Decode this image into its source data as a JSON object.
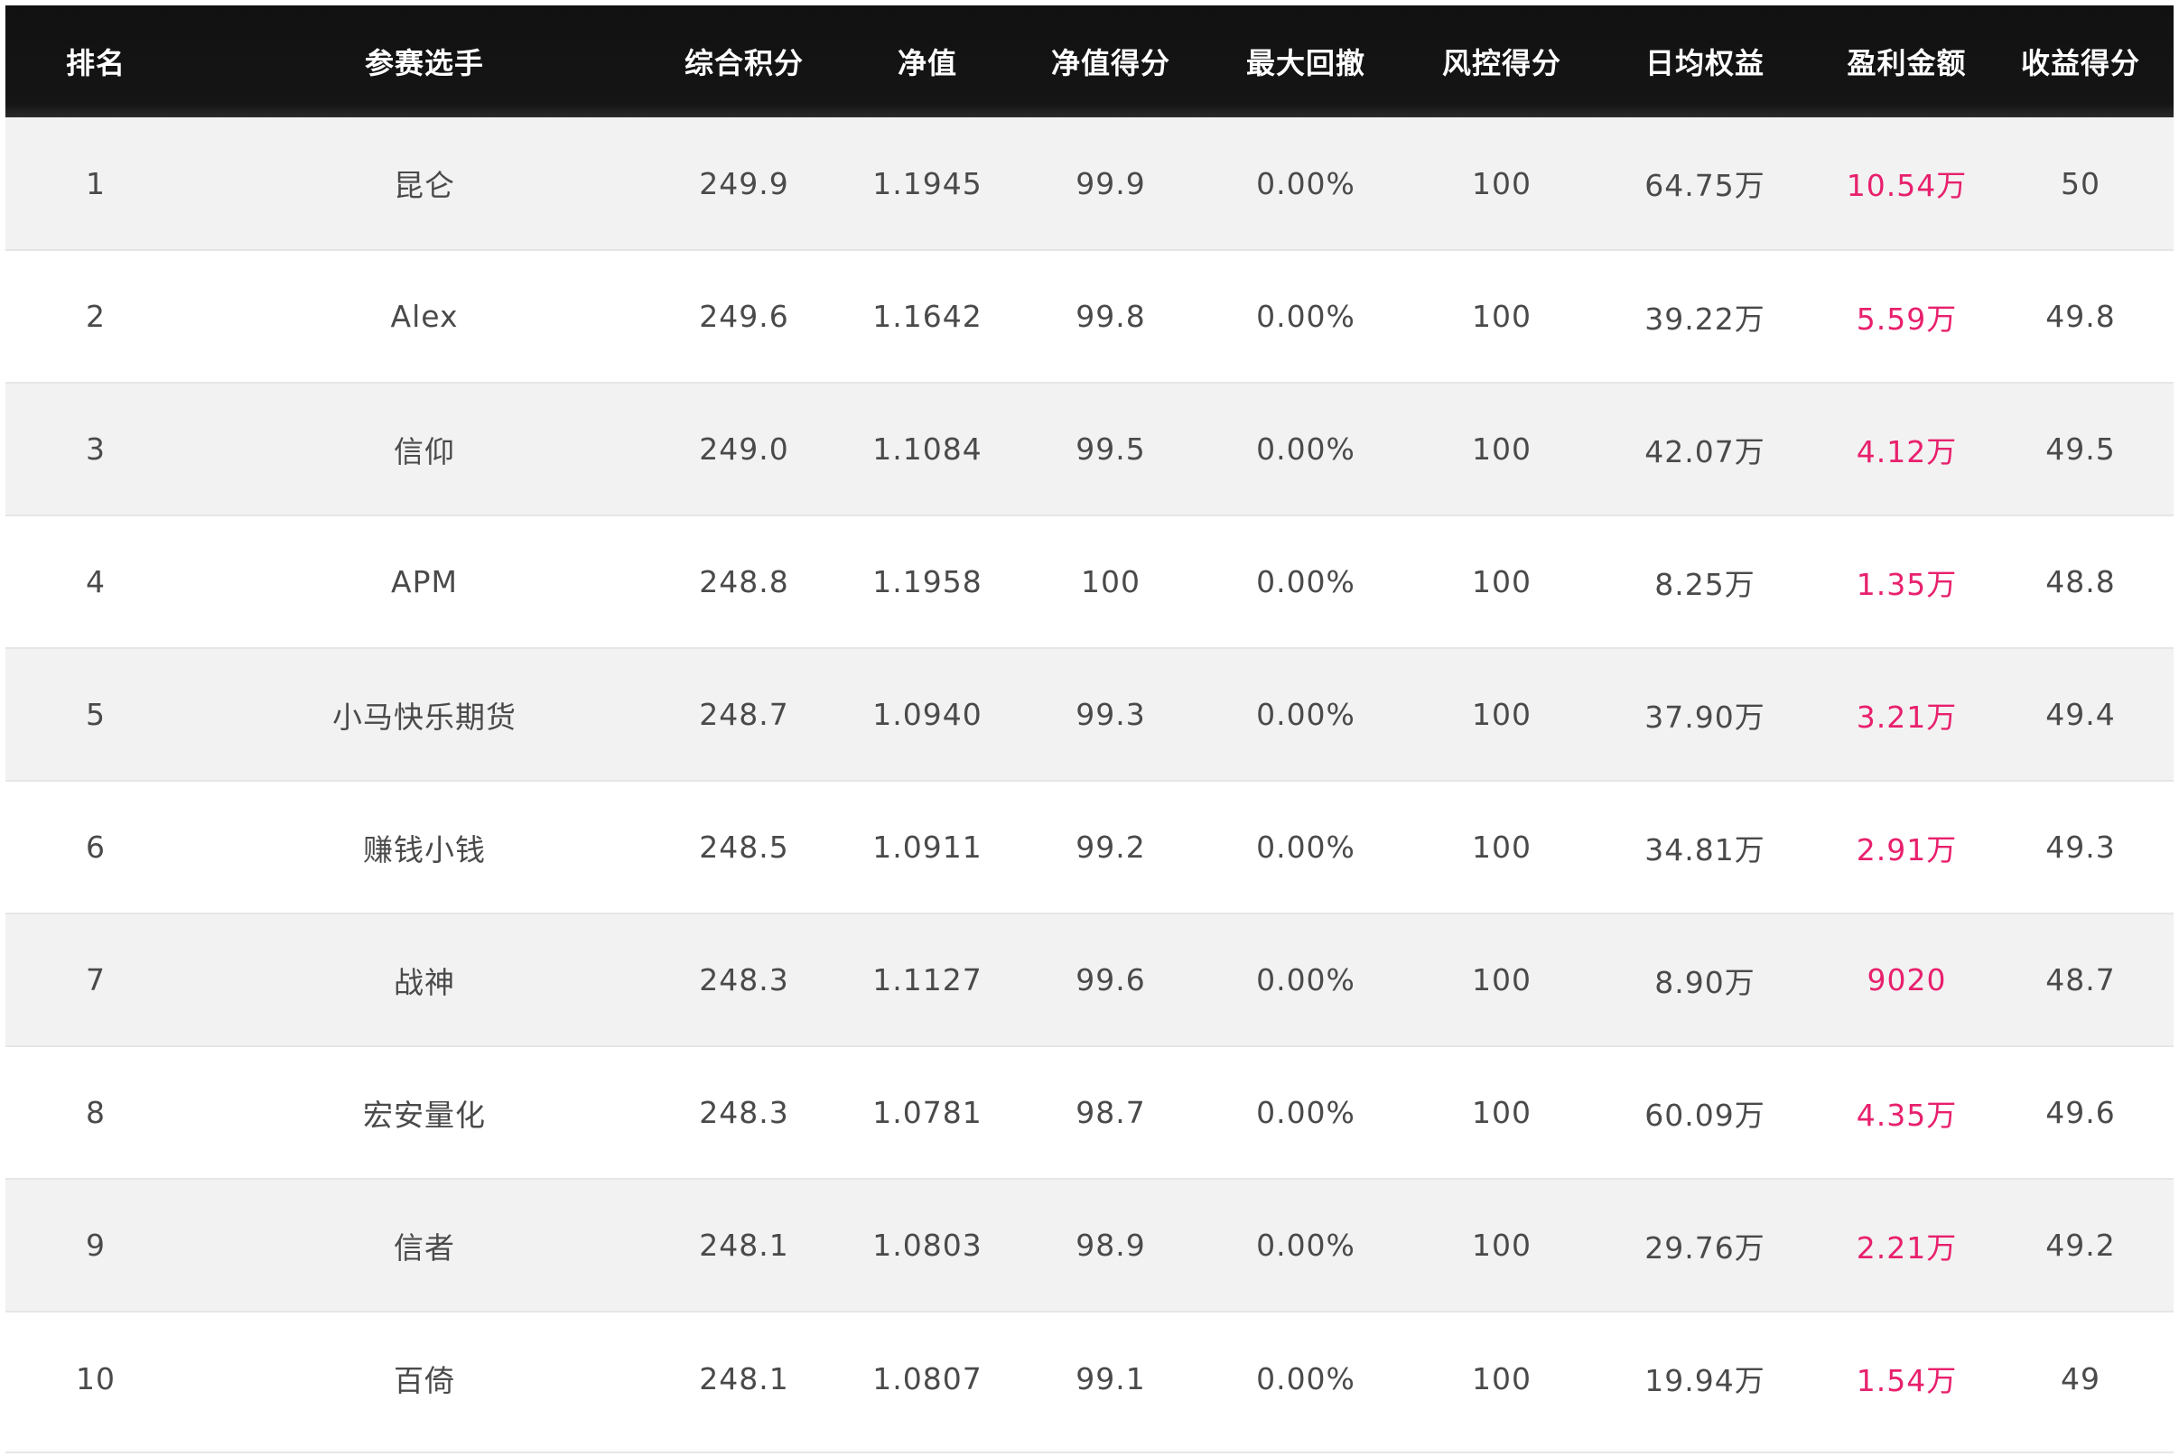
{
  "table": {
    "headers": [
      "排名",
      "参赛选手",
      "综合积分",
      "净值",
      "净值得分",
      "最大回撤",
      "风控得分",
      "日均权益",
      "盈利金额",
      "收益得分"
    ],
    "rows": [
      [
        "1",
        "昆仑",
        "249.9",
        "1.1945",
        "99.9",
        "0.00%",
        "100",
        "64.75万",
        "10.54万",
        "50"
      ],
      [
        "2",
        "Alex",
        "249.6",
        "1.1642",
        "99.8",
        "0.00%",
        "100",
        "39.22万",
        "5.59万",
        "49.8"
      ],
      [
        "3",
        "信仰",
        "249.0",
        "1.1084",
        "99.5",
        "0.00%",
        "100",
        "42.07万",
        "4.12万",
        "49.5"
      ],
      [
        "4",
        "APM",
        "248.8",
        "1.1958",
        "100",
        "0.00%",
        "100",
        "8.25万",
        "1.35万",
        "48.8"
      ],
      [
        "5",
        "小马快乐期货",
        "248.7",
        "1.0940",
        "99.3",
        "0.00%",
        "100",
        "37.90万",
        "3.21万",
        "49.4"
      ],
      [
        "6",
        "赚钱小钱",
        "248.5",
        "1.0911",
        "99.2",
        "0.00%",
        "100",
        "34.81万",
        "2.91万",
        "49.3"
      ],
      [
        "7",
        "战神",
        "248.3",
        "1.1127",
        "99.6",
        "0.00%",
        "100",
        "8.90万",
        "9020",
        "48.7"
      ],
      [
        "8",
        "宏安量化",
        "248.3",
        "1.0781",
        "98.7",
        "0.00%",
        "100",
        "60.09万",
        "4.35万",
        "49.6"
      ],
      [
        "9",
        "信者",
        "248.1",
        "1.0803",
        "98.9",
        "0.00%",
        "100",
        "29.76万",
        "2.21万",
        "49.2"
      ],
      [
        "10",
        "百倚",
        "248.1",
        "1.0807",
        "99.1",
        "0.00%",
        "100",
        "19.94万",
        "1.54万",
        "49"
      ]
    ]
  },
  "colors": {
    "header_bg": "#111111",
    "header_text": "#ffffff",
    "row_odd_bg": "#f2f2f2",
    "row_even_bg": "#ffffff",
    "cell_text": "#4a4a4a",
    "profit_text": "#e8206d"
  }
}
